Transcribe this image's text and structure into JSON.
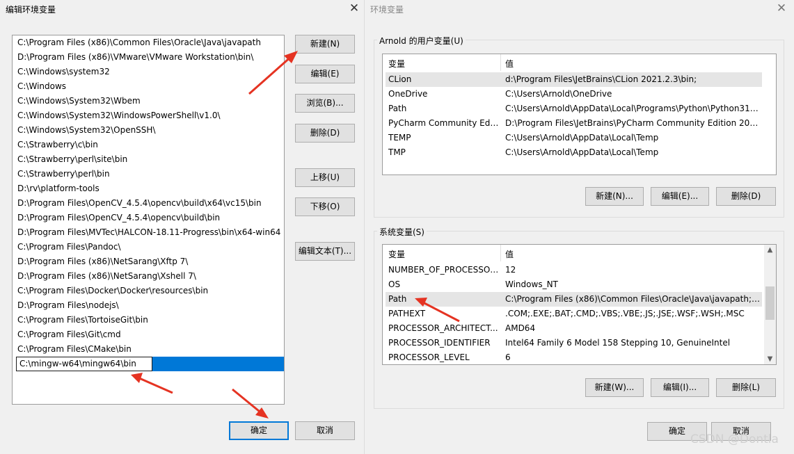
{
  "left": {
    "title": "编辑环境变量",
    "close": "✕",
    "paths": [
      "C:\\Program Files (x86)\\Common Files\\Oracle\\Java\\javapath",
      "D:\\Program Files (x86)\\VMware\\VMware Workstation\\bin\\",
      "C:\\Windows\\system32",
      "C:\\Windows",
      "C:\\Windows\\System32\\Wbem",
      "C:\\Windows\\System32\\WindowsPowerShell\\v1.0\\",
      "C:\\Windows\\System32\\OpenSSH\\",
      "C:\\Strawberry\\c\\bin",
      "C:\\Strawberry\\perl\\site\\bin",
      "C:\\Strawberry\\perl\\bin",
      "D:\\rv\\platform-tools",
      "D:\\Program Files\\OpenCV_4.5.4\\opencv\\build\\x64\\vc15\\bin",
      "D:\\Program Files\\OpenCV_4.5.4\\opencv\\build\\bin",
      "D:\\Program Files\\MVTec\\HALCON-18.11-Progress\\bin\\x64-win64",
      "C:\\Program Files\\Pandoc\\",
      "D:\\Program Files (x86)\\NetSarang\\Xftp 7\\",
      "D:\\Program Files (x86)\\NetSarang\\Xshell 7\\",
      "C:\\Program Files\\Docker\\Docker\\resources\\bin",
      "D:\\Program Files\\nodejs\\",
      "C:\\Program Files\\TortoiseGit\\bin",
      "C:\\Program Files\\Git\\cmd",
      "C:\\Program Files\\CMake\\bin"
    ],
    "editing_value": "C:\\mingw-w64\\mingw64\\bin",
    "buttons": {
      "new": "新建(N)",
      "edit": "编辑(E)",
      "browse": "浏览(B)...",
      "delete": "删除(D)",
      "up": "上移(U)",
      "down": "下移(O)",
      "edit_text": "编辑文本(T)..."
    },
    "ok": "确定",
    "cancel": "取消"
  },
  "right": {
    "title": "环境变量",
    "close": "✕",
    "user_group_label": "Arnold 的用户变量(U)",
    "col_var": "变量",
    "col_val": "值",
    "user_vars": [
      {
        "name": "CLion",
        "value": "d:\\Program Files\\JetBrains\\CLion 2021.2.3\\bin;"
      },
      {
        "name": "OneDrive",
        "value": "C:\\Users\\Arnold\\OneDrive"
      },
      {
        "name": "Path",
        "value": "C:\\Users\\Arnold\\AppData\\Local\\Programs\\Python\\Python313..."
      },
      {
        "name": "PyCharm Community Editi...",
        "value": "D:\\Program Files\\JetBrains\\PyCharm Community Edition 2021..."
      },
      {
        "name": "TEMP",
        "value": "C:\\Users\\Arnold\\AppData\\Local\\Temp"
      },
      {
        "name": "TMP",
        "value": "C:\\Users\\Arnold\\AppData\\Local\\Temp"
      }
    ],
    "user_buttons": {
      "new": "新建(N)...",
      "edit": "编辑(E)...",
      "delete": "删除(D)"
    },
    "sys_group_label": "系统变量(S)",
    "sys_vars": [
      {
        "name": "NUMBER_OF_PROCESSORS",
        "value": "12"
      },
      {
        "name": "OS",
        "value": "Windows_NT"
      },
      {
        "name": "Path",
        "value": "C:\\Program Files (x86)\\Common Files\\Oracle\\Java\\javapath;D:..."
      },
      {
        "name": "PATHEXT",
        "value": ".COM;.EXE;.BAT;.CMD;.VBS;.VBE;.JS;.JSE;.WSF;.WSH;.MSC"
      },
      {
        "name": "PROCESSOR_ARCHITECT...",
        "value": "AMD64"
      },
      {
        "name": "PROCESSOR_IDENTIFIER",
        "value": "Intel64 Family 6 Model 158 Stepping 10, GenuineIntel"
      },
      {
        "name": "PROCESSOR_LEVEL",
        "value": "6"
      }
    ],
    "sys_buttons": {
      "new": "新建(W)...",
      "edit": "编辑(I)...",
      "delete": "删除(L)"
    },
    "ok": "确定",
    "cancel": "取消"
  },
  "watermark": "CSDN @Dontla",
  "colors": {
    "selection": "#0078d7",
    "annotation_arrow": "#e53322"
  }
}
